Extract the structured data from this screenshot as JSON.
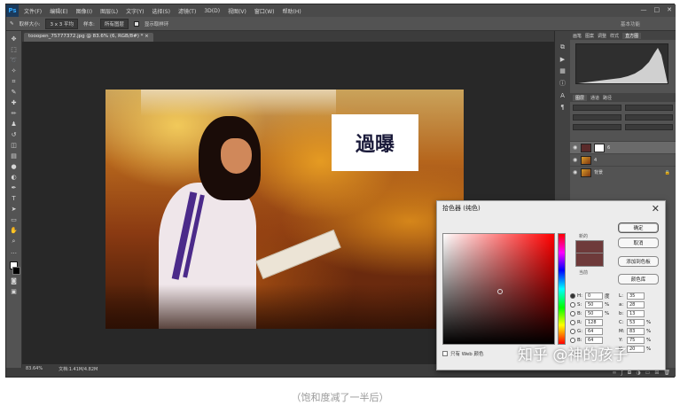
{
  "menubar": {
    "logo": "Ps",
    "items": [
      "文件(F)",
      "编辑(E)",
      "图像(I)",
      "图层(L)",
      "文字(Y)",
      "选择(S)",
      "滤镜(T)",
      "3D(D)",
      "视图(V)",
      "窗口(W)",
      "帮助(H)"
    ],
    "controls": [
      "—",
      "□",
      "✕"
    ]
  },
  "optionsbar": {
    "sample_size_label": "取样大小:",
    "sample_size_value": "3 x 3 平均",
    "sample_label": "样本:",
    "sample_value": "所有图层",
    "show_ring_label": "显示取样环",
    "workspace": "基本功能"
  },
  "document": {
    "tab_label": "tooopen_75777372.jpg @ 83.6% (6, RGB/8#) * ×",
    "caption_text": "過曝"
  },
  "statusbar": {
    "zoom": "83.64%",
    "doc_info": "文档:1.41M/4.82M"
  },
  "panels": {
    "top_tabs": [
      "画笔",
      "图案",
      "调整",
      "样式",
      "直方图"
    ],
    "layer_tabs": [
      "图层",
      "通道",
      "路径"
    ],
    "layers": [
      {
        "name": "6",
        "thumb": "red"
      },
      {
        "name": "4",
        "thumb": "photo"
      },
      {
        "name": "背景",
        "thumb": "photo",
        "lock": "🔒"
      }
    ]
  },
  "color_picker": {
    "title": "拾色器 (纯色)",
    "close": "✕",
    "new_label": "新的",
    "current_label": "当前",
    "buttons": {
      "ok": "确定",
      "cancel": "取消",
      "add_swatch": "添加到色板",
      "libraries": "颜色库"
    },
    "fields": {
      "H": {
        "value": "0",
        "unit": "度"
      },
      "S": {
        "value": "50",
        "unit": "%"
      },
      "B": {
        "value": "50",
        "unit": "%"
      },
      "R": {
        "value": "128",
        "unit": ""
      },
      "G": {
        "value": "64",
        "unit": ""
      },
      "B2": {
        "value": "64",
        "unit": ""
      },
      "L": {
        "value": "35",
        "unit": ""
      },
      "a": {
        "value": "28",
        "unit": ""
      },
      "b": {
        "value": "13",
        "unit": ""
      },
      "C": {
        "value": "53",
        "unit": "%"
      },
      "M": {
        "value": "83",
        "unit": "%"
      },
      "Y": {
        "value": "75",
        "unit": "%"
      },
      "K": {
        "value": "20",
        "unit": "%"
      }
    },
    "web_only_label": "只有 Web 颜色",
    "selected_color": "#804040"
  },
  "watermark": "知乎 @神的孩子",
  "figure_caption": "（饱和度减了一半后）"
}
